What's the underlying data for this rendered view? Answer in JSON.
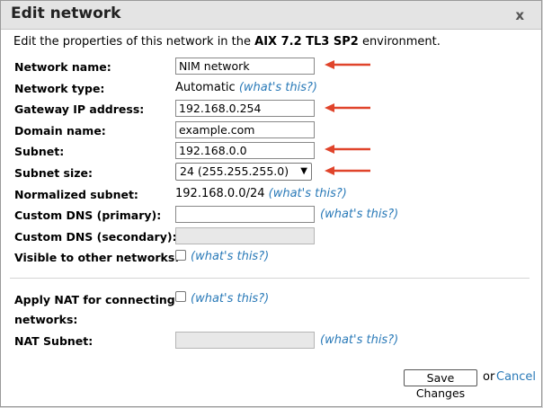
{
  "dialog": {
    "title": "Edit network",
    "close_label": "x",
    "intro_prefix": "Edit the properties of this network in the ",
    "intro_env": "AIX 7.2 TL3 SP2",
    "intro_suffix": " environment."
  },
  "fields": {
    "network_name": {
      "label": "Network name:",
      "value": "NIM network"
    },
    "network_type": {
      "label": "Network type:",
      "value": "Automatic",
      "help": "(what's this?)"
    },
    "gateway": {
      "label": "Gateway IP address:",
      "value": "192.168.0.254"
    },
    "domain": {
      "label": "Domain name:",
      "value": "example.com"
    },
    "subnet": {
      "label": "Subnet:",
      "value": "192.168.0.0"
    },
    "subnet_size": {
      "label": "Subnet size:",
      "value": "24 (255.255.255.0)"
    },
    "normalized_subnet": {
      "label": "Normalized subnet:",
      "value": "192.168.0.0/24",
      "help": "(what's this?)"
    },
    "dns_primary": {
      "label": "Custom DNS (primary):",
      "value": "",
      "help": "(what's this?)"
    },
    "dns_secondary": {
      "label": "Custom DNS (secondary):",
      "value": ""
    },
    "visible": {
      "label": "Visible to other networks:",
      "checked": false,
      "help": "(what's this?)"
    },
    "apply_nat": {
      "label_line1": "Apply NAT for connecting",
      "label_line2": "networks:",
      "checked": false,
      "help": "(what's this?)"
    },
    "nat_subnet": {
      "label": "NAT Subnet:",
      "value": "",
      "help": "(what's this?)"
    }
  },
  "actions": {
    "save_label": "Save Changes",
    "or_text": "or",
    "cancel_label": "Cancel"
  },
  "colors": {
    "annotation_arrow": "#e0442b",
    "link": "#2a7ab8"
  }
}
